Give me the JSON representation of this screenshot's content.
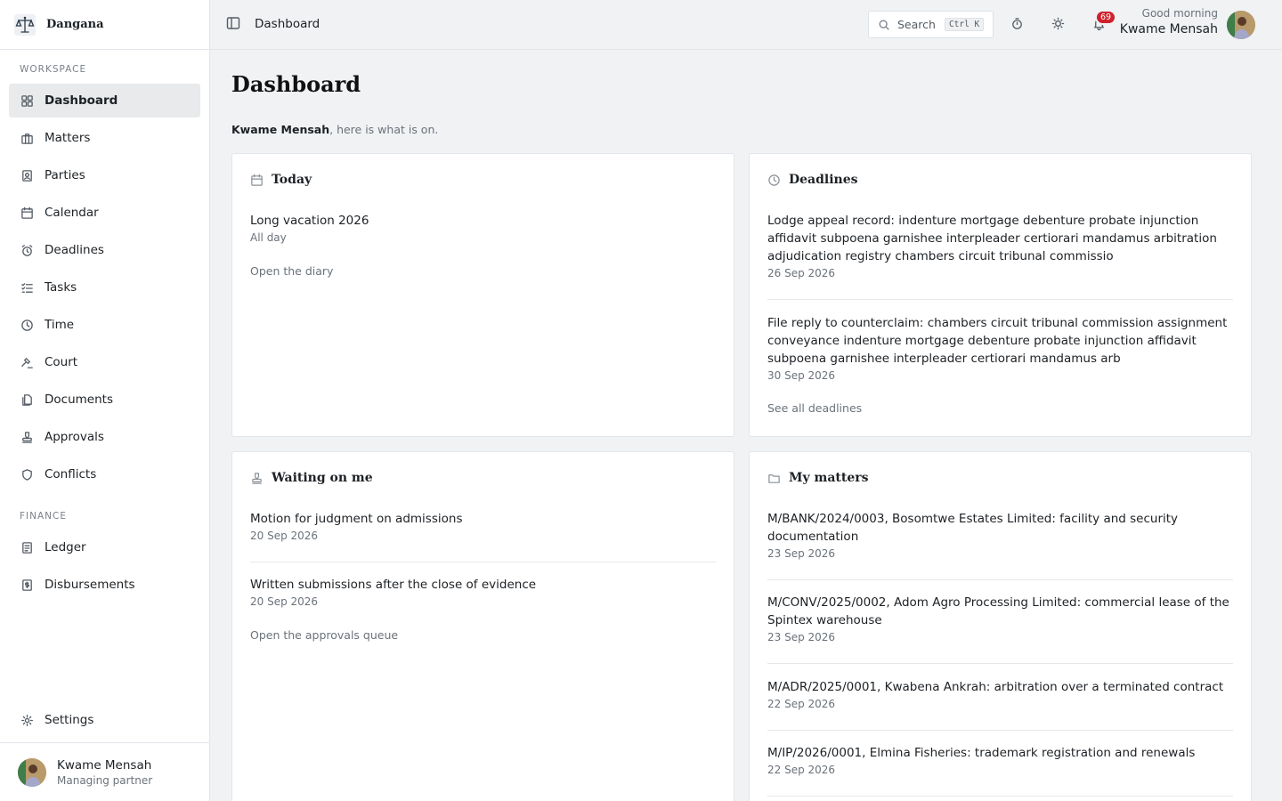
{
  "brand": {
    "name": "Dangana",
    "logo_icon": "scales-of-justice-icon"
  },
  "sidebar": {
    "sections": [
      {
        "label": "WORKSPACE"
      },
      {
        "label": "FINANCE"
      }
    ],
    "items": [
      {
        "label": "Dashboard",
        "icon": "grid-icon"
      },
      {
        "label": "Matters",
        "icon": "briefcase-icon"
      },
      {
        "label": "Parties",
        "icon": "contact-card-icon"
      },
      {
        "label": "Calendar",
        "icon": "calendar-icon"
      },
      {
        "label": "Deadlines",
        "icon": "alarm-clock-icon"
      },
      {
        "label": "Tasks",
        "icon": "checklist-icon"
      },
      {
        "label": "Time",
        "icon": "clock-icon"
      },
      {
        "label": "Court",
        "icon": "gavel-icon"
      },
      {
        "label": "Documents",
        "icon": "documents-icon"
      },
      {
        "label": "Approvals",
        "icon": "stamp-icon"
      },
      {
        "label": "Conflicts",
        "icon": "shield-icon"
      },
      {
        "label": "Ledger",
        "icon": "ledger-icon"
      },
      {
        "label": "Disbursements",
        "icon": "receipt-icon"
      },
      {
        "label": "Settings",
        "icon": "gear-icon"
      }
    ],
    "active": "Dashboard",
    "user": {
      "name": "Kwame Mensah",
      "role": "Managing partner"
    }
  },
  "topbar": {
    "breadcrumb": "Dashboard",
    "search_label": "Search",
    "search_shortcut": "Ctrl K",
    "notification_count": "69",
    "greeting": "Good morning",
    "user_name": "Kwame Mensah"
  },
  "main": {
    "title": "Dashboard",
    "welcome_name": "Kwame Mensah",
    "welcome_rest": ", here is what is on."
  },
  "cards": {
    "today": {
      "title": "Today",
      "items": [
        {
          "title": "Long vacation 2026",
          "sub": "All day"
        }
      ],
      "link": "Open the diary"
    },
    "deadlines": {
      "title": "Deadlines",
      "items": [
        {
          "title": "Lodge appeal record: indenture mortgage debenture probate injunction affidavit subpoena garnishee interpleader certiorari mandamus arbitration adjudication registry chambers circuit tribunal commissio",
          "date": "26 Sep 2026"
        },
        {
          "title": "File reply to counterclaim: chambers circuit tribunal commission assignment conveyance indenture mortgage debenture probate injunction affidavit subpoena garnishee interpleader certiorari mandamus arb",
          "date": "30 Sep 2026"
        }
      ],
      "link": "See all deadlines"
    },
    "waiting": {
      "title": "Waiting on me",
      "items": [
        {
          "title": "Motion for judgment on admissions",
          "date": "20 Sep 2026"
        },
        {
          "title": "Written submissions after the close of evidence",
          "date": "20 Sep 2026"
        }
      ],
      "link": "Open the approvals queue"
    },
    "matters": {
      "title": "My matters",
      "items": [
        {
          "title": "M/BANK/2024/0003, Bosomtwe Estates Limited: facility and security documentation",
          "date": "23 Sep 2026"
        },
        {
          "title": "M/CONV/2025/0002, Adom Agro Processing Limited: commercial lease of the Spintex warehouse",
          "date": "23 Sep 2026"
        },
        {
          "title": "M/ADR/2025/0001, Kwabena Ankrah: arbitration over a terminated contract",
          "date": "22 Sep 2026"
        },
        {
          "title": "M/IP/2026/0001, Elmina Fisheries: trademark registration and renewals",
          "date": "22 Sep 2026"
        }
      ]
    }
  },
  "colors": {
    "accent_badge": "#d0202a",
    "background": "#f0f2f4",
    "active_nav": "#e8eaec"
  }
}
